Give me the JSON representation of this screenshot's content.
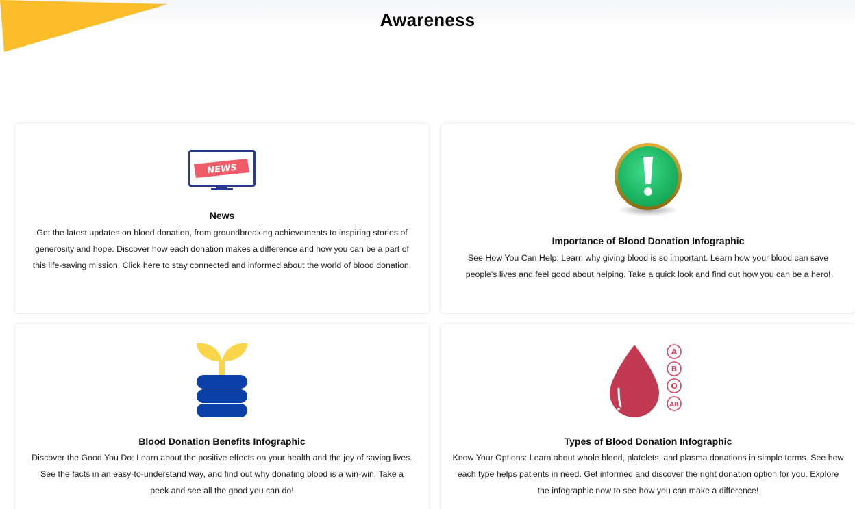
{
  "header": {
    "title": "Awareness",
    "accent_color": "#fbbd2a"
  },
  "cards": [
    {
      "icon": "news-monitor-icon",
      "icon_text": "NEWS",
      "title": "News",
      "description": "Get the latest updates on blood donation, from groundbreaking achievements to inspiring stories of generosity and hope. Discover how each donation makes a difference and how you can be a part of this life-saving mission. Click here to stay connected and informed about the world of blood donation."
    },
    {
      "icon": "exclamation-circle-icon",
      "title": "Importance of Blood Donation Infographic",
      "description": "See How You Can Help: Learn why giving blood is so important. Learn how your blood can save people's lives and feel good about helping. Take a quick look and find out how you can be a hero!"
    },
    {
      "icon": "sprout-plant-icon",
      "title": "Blood Donation Benefits Infographic",
      "description": "Discover the Good You Do: Learn about the positive effects on your health and the joy of saving lives. See the facts in an easy-to-understand way, and find out why donating blood is a win-win. Take a peek and see all the good you can do!"
    },
    {
      "icon": "blood-drop-types-icon",
      "icon_labels": [
        "A",
        "B",
        "O",
        "AB"
      ],
      "title": "Types of Blood Donation Infographic",
      "description": "Know Your Options: Learn about whole blood, platelets, and plasma donations in simple terms. See how each type helps patients in need. Get informed and discover the right donation option for you. Explore the infographic now to see how you can make a difference!"
    }
  ]
}
